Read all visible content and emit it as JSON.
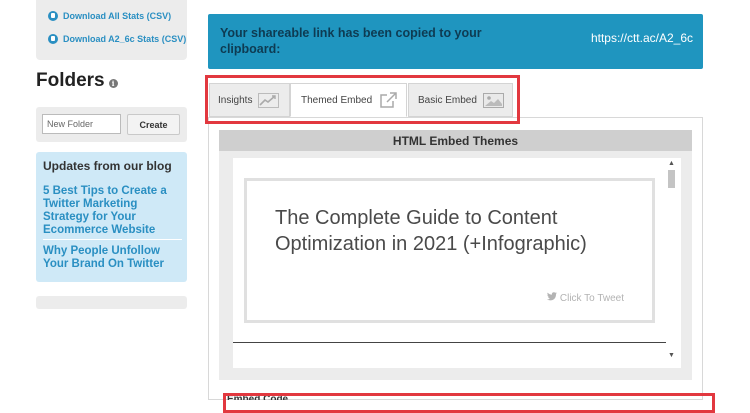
{
  "sidebar": {
    "downloads": [
      {
        "label": "Download All Stats (CSV)"
      },
      {
        "label": "Download A2_6c Stats (CSV)"
      }
    ],
    "folders_title": "Folders",
    "folder_input_placeholder": "New Folder",
    "create_label": "Create",
    "blog": {
      "title": "Updates from our blog",
      "items": [
        {
          "label": "5 Best Tips to Create a Twitter Marketing Strategy for Your Ecommerce Website"
        },
        {
          "label": "Why People Unfollow Your Brand On Twitter"
        }
      ]
    }
  },
  "notice": {
    "message": "Your shareable link has been copied to your clipboard:",
    "link": "https://ctt.ac/A2_6c"
  },
  "tabs": [
    {
      "label": "Insights",
      "icon": "chart-icon"
    },
    {
      "label": "Themed Embed",
      "icon": "external-link-icon"
    },
    {
      "label": "Basic Embed",
      "icon": "image-icon"
    }
  ],
  "embed": {
    "header": "HTML Embed Themes",
    "card_title": "The Complete Guide to Content Optimization in 2021 (+Infographic)",
    "click_to_tweet": "Click To Tweet",
    "bottom_label": "Embed Code"
  },
  "colors": {
    "accent_blue": "#1f95bf",
    "link_blue": "#2a8fc2",
    "highlight_red": "#e2383f",
    "blog_bg": "#cfe9f7"
  }
}
